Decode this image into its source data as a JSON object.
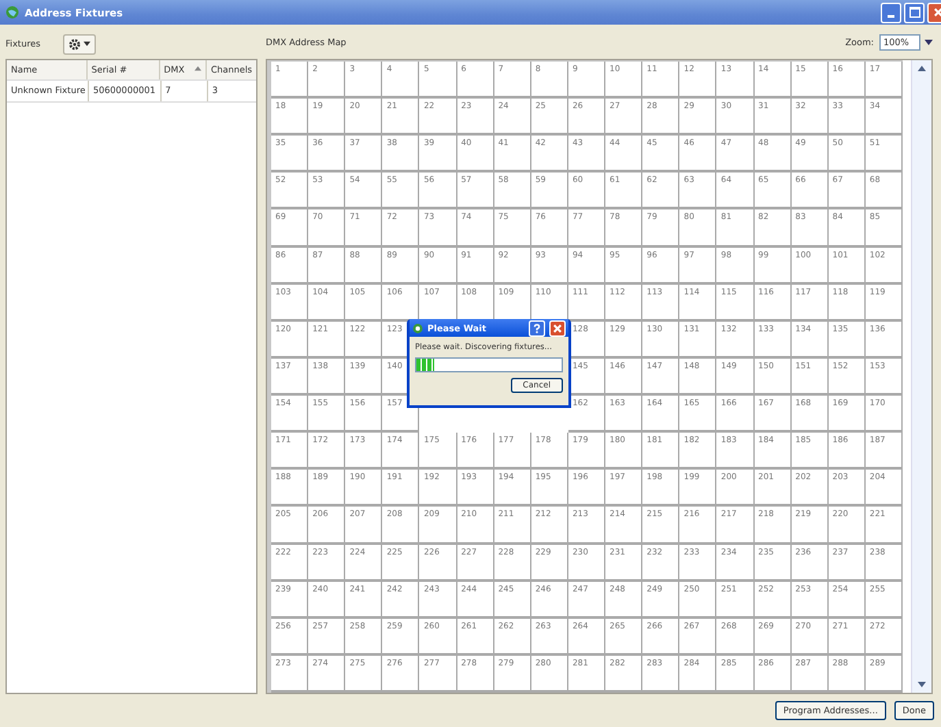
{
  "window": {
    "title": "Address Fixtures"
  },
  "fixtures": {
    "label": "Fixtures",
    "columns": [
      "Name",
      "Serial #",
      "DMX",
      "Channels"
    ],
    "rows": [
      [
        "Unknown Fixture",
        "50600000001",
        "7",
        "3"
      ]
    ]
  },
  "map": {
    "title": "DMX Address Map",
    "zoom_label": "Zoom:",
    "zoom_value": "100%",
    "rows": [
      [
        "1",
        "2",
        "3",
        "4",
        "5",
        "6",
        "7",
        "8",
        "9",
        "10",
        "11",
        "12",
        "13",
        "14",
        "15",
        "16",
        "17"
      ],
      [
        "18",
        "19",
        "20",
        "21",
        "22",
        "23",
        "24",
        "25",
        "26",
        "27",
        "28",
        "29",
        "30",
        "31",
        "32",
        "33",
        "34"
      ],
      [
        "35",
        "36",
        "37",
        "38",
        "39",
        "40",
        "41",
        "42",
        "43",
        "44",
        "45",
        "46",
        "47",
        "48",
        "49",
        "50",
        "51"
      ],
      [
        "52",
        "53",
        "54",
        "55",
        "56",
        "57",
        "58",
        "59",
        "60",
        "61",
        "62",
        "63",
        "64",
        "65",
        "66",
        "67",
        "68"
      ],
      [
        "69",
        "70",
        "71",
        "72",
        "73",
        "74",
        "75",
        "76",
        "77",
        "78",
        "79",
        "80",
        "81",
        "82",
        "83",
        "84",
        "85"
      ],
      [
        "86",
        "87",
        "88",
        "89",
        "90",
        "91",
        "92",
        "93",
        "94",
        "95",
        "96",
        "97",
        "98",
        "99",
        "100",
        "101",
        "102"
      ],
      [
        "103",
        "104",
        "105",
        "106",
        "107",
        "108",
        "109",
        "110",
        "111",
        "112",
        "113",
        "114",
        "115",
        "116",
        "117",
        "118",
        "119"
      ],
      [
        "120",
        "121",
        "122",
        "123",
        null,
        null,
        null,
        null,
        "128",
        "129",
        "130",
        "131",
        "132",
        "133",
        "134",
        "135",
        "136"
      ],
      [
        "137",
        "138",
        "139",
        "140",
        null,
        null,
        null,
        null,
        "145",
        "146",
        "147",
        "148",
        "149",
        "150",
        "151",
        "152",
        "153"
      ],
      [
        "154",
        "155",
        "156",
        "157",
        null,
        null,
        null,
        null,
        "162",
        "163",
        "164",
        "165",
        "166",
        "167",
        "168",
        "169",
        "170"
      ],
      [
        "171",
        "172",
        "173",
        "174",
        "175",
        "176",
        "177",
        "178",
        "179",
        "180",
        "181",
        "182",
        "183",
        "184",
        "185",
        "186",
        "187"
      ],
      [
        "188",
        "189",
        "190",
        "191",
        "192",
        "193",
        "194",
        "195",
        "196",
        "197",
        "198",
        "199",
        "200",
        "201",
        "202",
        "203",
        "204"
      ],
      [
        "205",
        "206",
        "207",
        "208",
        "209",
        "210",
        "211",
        "212",
        "213",
        "214",
        "215",
        "216",
        "217",
        "218",
        "219",
        "220",
        "221"
      ],
      [
        "222",
        "223",
        "224",
        "225",
        "226",
        "227",
        "228",
        "229",
        "230",
        "231",
        "232",
        "233",
        "234",
        "235",
        "236",
        "237",
        "238"
      ],
      [
        "239",
        "240",
        "241",
        "242",
        "243",
        "244",
        "245",
        "246",
        "247",
        "248",
        "249",
        "250",
        "251",
        "252",
        "253",
        "254",
        "255"
      ],
      [
        "256",
        "257",
        "258",
        "259",
        "260",
        "261",
        "262",
        "263",
        "264",
        "265",
        "266",
        "267",
        "268",
        "269",
        "270",
        "271",
        "272"
      ],
      [
        "273",
        "274",
        "275",
        "276",
        "277",
        "278",
        "279",
        "280",
        "281",
        "282",
        "283",
        "284",
        "285",
        "286",
        "287",
        "288",
        "289"
      ]
    ]
  },
  "dialog": {
    "title": "Please Wait",
    "message": "Please wait. Discovering fixtures...",
    "progress": {
      "level": 0.12
    },
    "button": "Cancel"
  },
  "buttons": [
    "Program Addresses...",
    "Done"
  ]
}
